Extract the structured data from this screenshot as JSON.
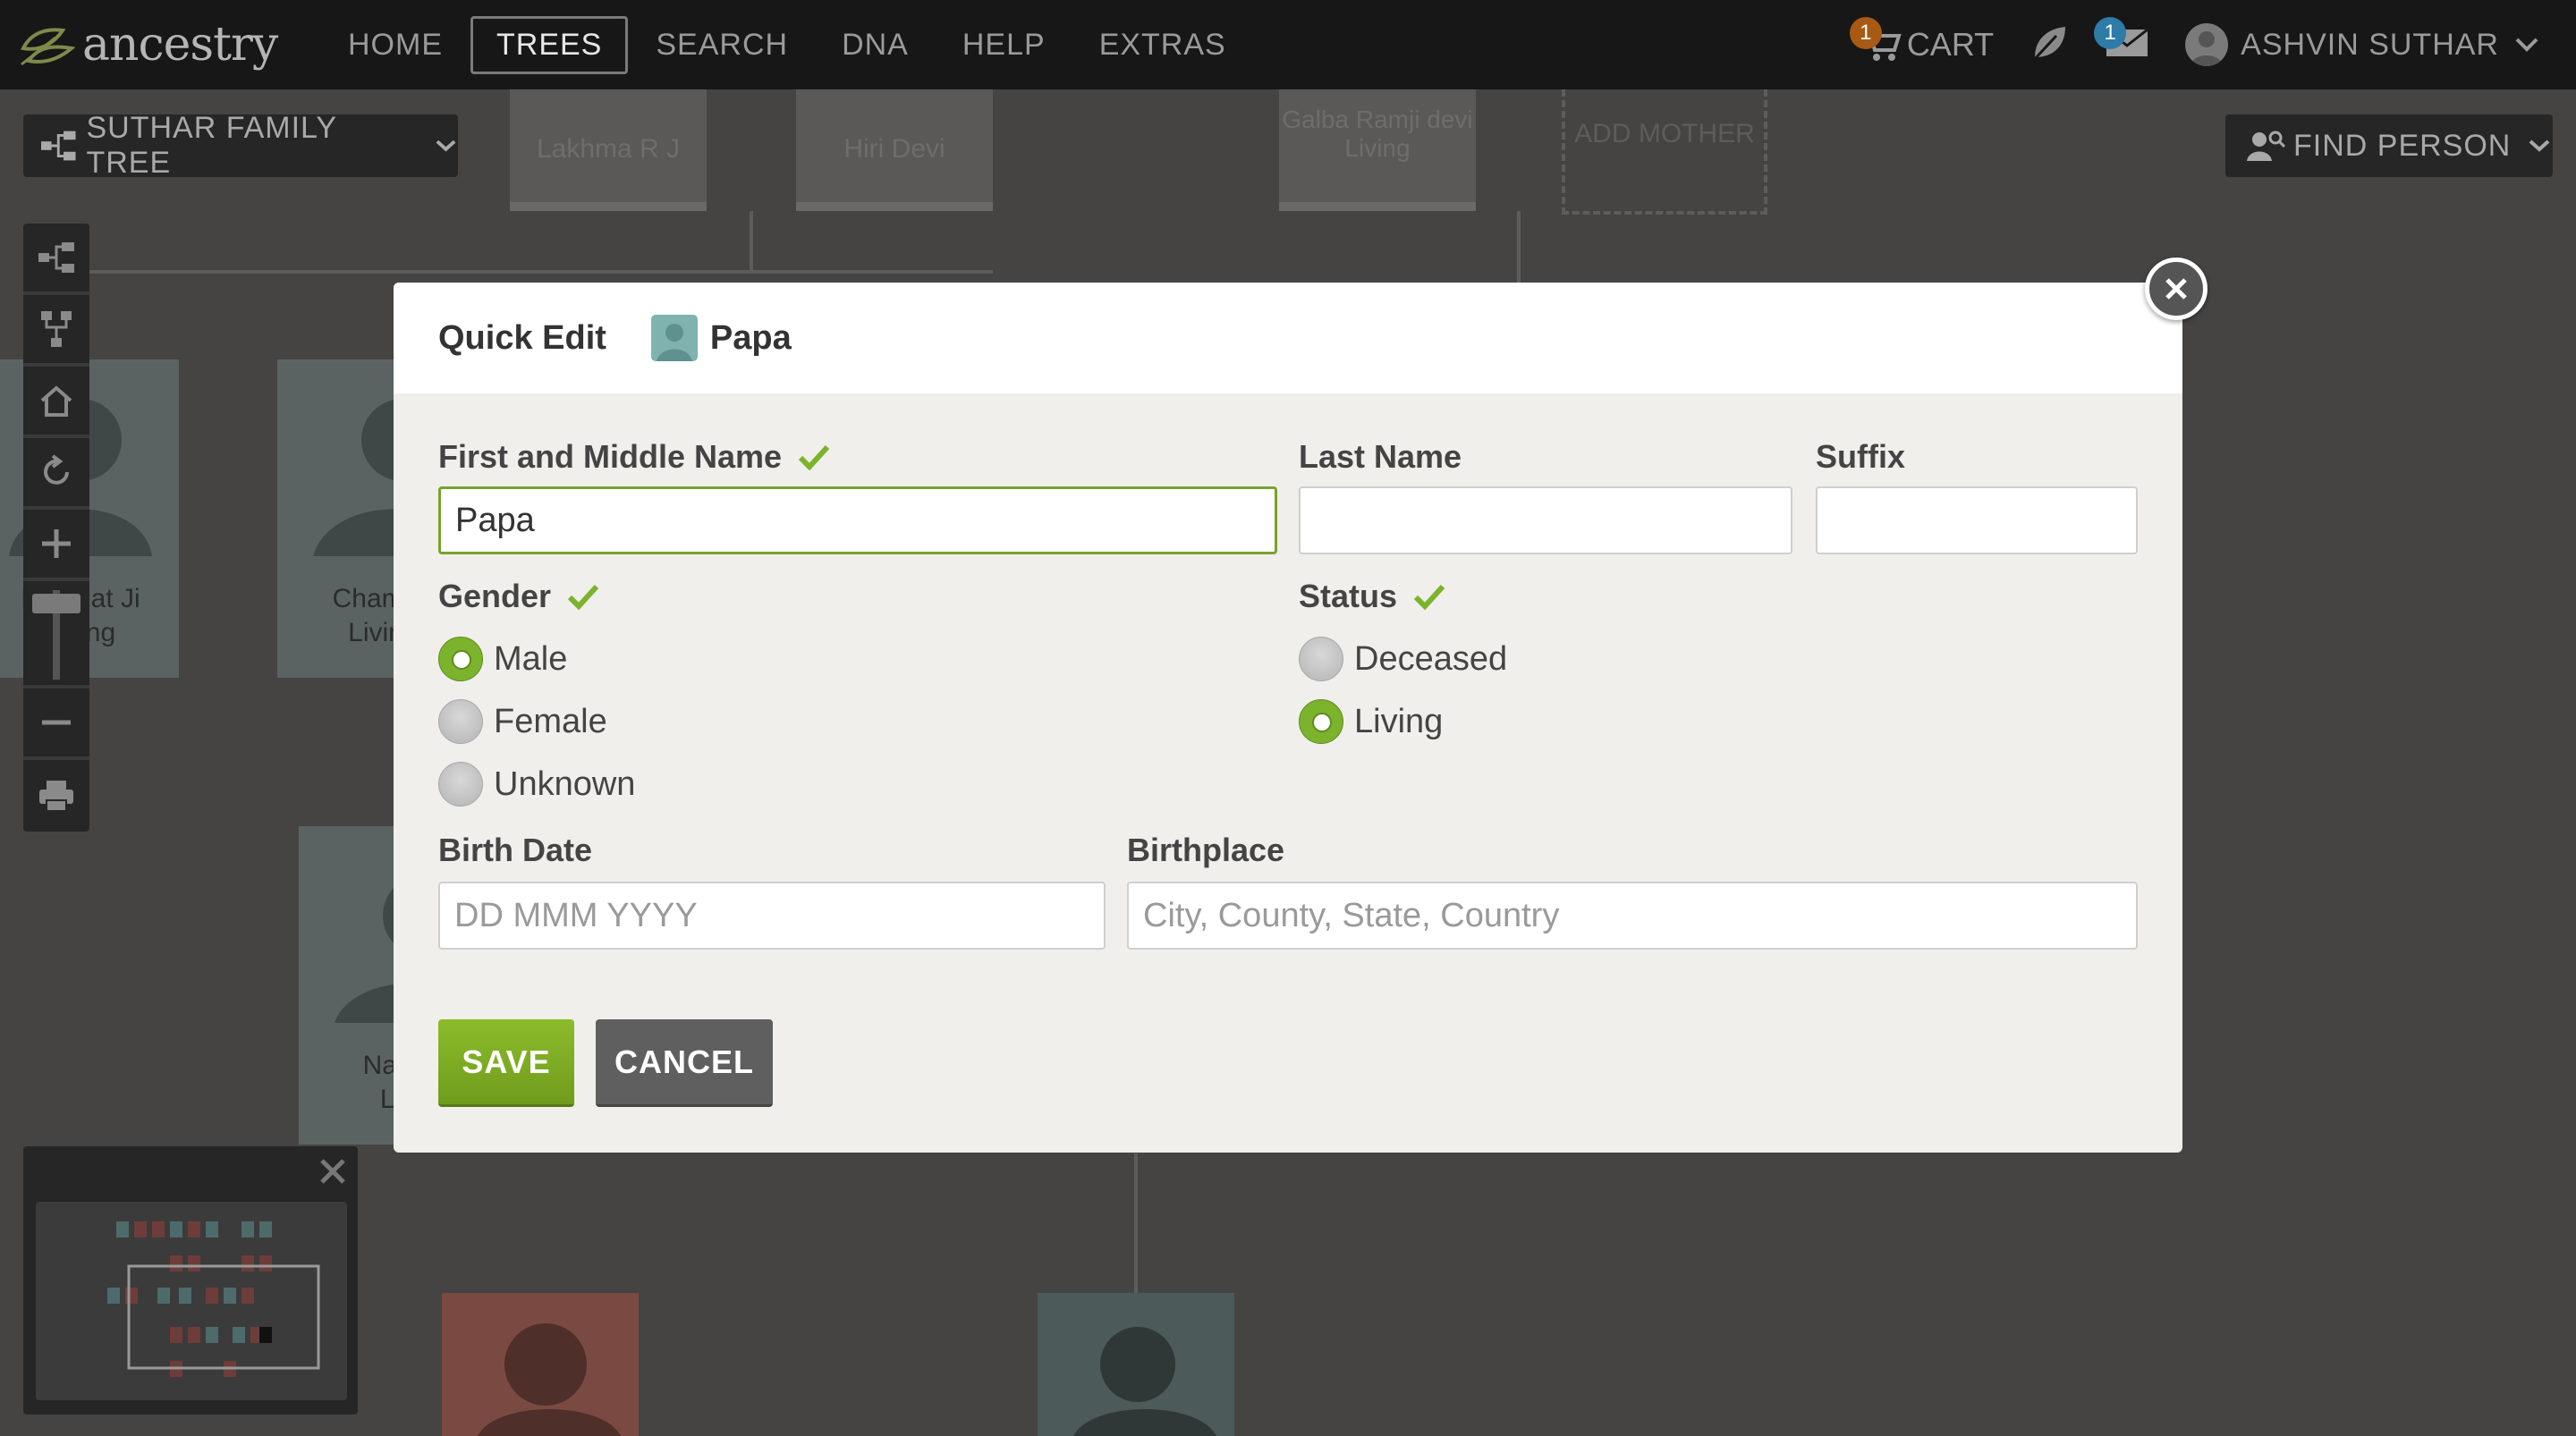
{
  "topnav": {
    "logo_text": "ancestry",
    "items": [
      {
        "label": "HOME",
        "active": false
      },
      {
        "label": "TREES",
        "active": true
      },
      {
        "label": "SEARCH",
        "active": false
      },
      {
        "label": "DNA",
        "active": false
      },
      {
        "label": "HELP",
        "active": false
      },
      {
        "label": "EXTRAS",
        "active": false
      }
    ],
    "cart_label": "CART",
    "cart_count": "1",
    "messages_count": "1",
    "user_name": "ASHVIN SUTHAR",
    "icons": [
      "cart-icon",
      "leaf-icon",
      "mail-icon",
      "user-avatar-icon",
      "chevron-down-icon"
    ]
  },
  "subbar": {
    "tree_name": "SUTHAR FAMILY TREE",
    "find_person_label": "FIND PERSON"
  },
  "background_tree": {
    "cards": [
      "Lakhma R J",
      "Hiri Devi",
      "Galba Ramji devi",
      "Living",
      "ADD MOTHER"
    ],
    "people": [
      {
        "name": "Himmat Ji",
        "status": "Living"
      },
      {
        "name": "Champ",
        "status": "Livin"
      },
      {
        "name": "Navin",
        "status": "Liv"
      }
    ]
  },
  "modal": {
    "title": "Quick Edit",
    "person_name": "Papa",
    "first_name": {
      "label": "First and Middle Name",
      "value": "Papa"
    },
    "last_name": {
      "label": "Last Name",
      "value": ""
    },
    "suffix": {
      "label": "Suffix",
      "value": ""
    },
    "gender": {
      "label": "Gender",
      "options": [
        {
          "label": "Male",
          "checked": true
        },
        {
          "label": "Female",
          "checked": false
        },
        {
          "label": "Unknown",
          "checked": false
        }
      ]
    },
    "status": {
      "label": "Status",
      "options": [
        {
          "label": "Deceased",
          "checked": false
        },
        {
          "label": "Living",
          "checked": true
        }
      ]
    },
    "birth_date": {
      "label": "Birth Date",
      "placeholder": "DD MMM YYYY"
    },
    "birthplace": {
      "label": "Birthplace",
      "placeholder": "City, County, State, Country"
    },
    "save_label": "SAVE",
    "cancel_label": "CANCEL"
  },
  "colors": {
    "accent_green": "#7cb32c",
    "nav_bg": "#171717",
    "overlay_bg": "#454443",
    "modal_bg": "#f0efec"
  }
}
